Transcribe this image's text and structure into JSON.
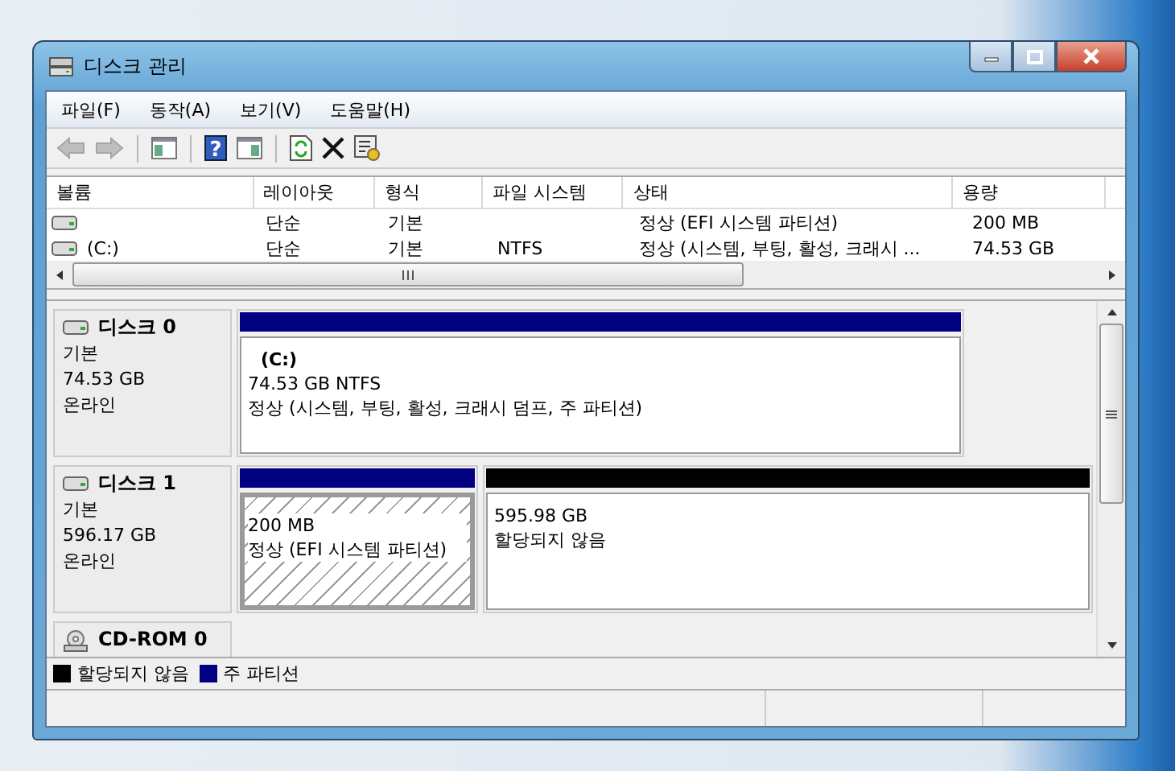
{
  "window": {
    "title": "디스크 관리"
  },
  "menu": [
    "파일(F)",
    "동작(A)",
    "보기(V)",
    "도움말(H)"
  ],
  "toolbar": [
    {
      "kind": "back",
      "disabled": true
    },
    {
      "kind": "forward",
      "disabled": true
    },
    {
      "kind": "sep"
    },
    {
      "kind": "panel-left",
      "disabled": false
    },
    {
      "kind": "sep"
    },
    {
      "kind": "help",
      "disabled": false,
      "glyph": "?"
    },
    {
      "kind": "panel-right",
      "disabled": false
    },
    {
      "kind": "sep"
    },
    {
      "kind": "refresh",
      "disabled": false
    },
    {
      "kind": "delete",
      "disabled": false
    },
    {
      "kind": "properties",
      "disabled": false
    }
  ],
  "volume_table": {
    "columns": [
      "볼륨",
      "레이아웃",
      "형식",
      "파일 시스템",
      "상태",
      "용량"
    ],
    "rows": [
      {
        "cells": [
          "",
          "단순",
          "기본",
          "",
          "정상 (EFI 시스템 파티션)",
          "200 MB"
        ]
      },
      {
        "cells": [
          "(C:)",
          "단순",
          "기본",
          "NTFS",
          "정상 (시스템, 부팅, 활성, 크래시 ...",
          "74.53 GB"
        ]
      }
    ]
  },
  "disks": [
    {
      "kind": "disk",
      "name": "디스크 0",
      "type": "기본",
      "size": "74.53 GB",
      "status": "온라인",
      "partitions": [
        {
          "kind": "primary",
          "selected": false,
          "label": "(C:)",
          "size": "74.53 GB NTFS",
          "status": "정상 (시스템, 부팅, 활성, 크래시 덤프, 주 파티션)"
        }
      ]
    },
    {
      "kind": "disk",
      "name": "디스크 1",
      "type": "기본",
      "size": "596.17 GB",
      "status": "온라인",
      "partitions": [
        {
          "kind": "primary",
          "selected": true,
          "size": "200 MB",
          "status": "정상 (EFI 시스템 파티션)"
        },
        {
          "kind": "unallocated",
          "selected": false,
          "size": "595.98 GB",
          "status": "할당되지 않음"
        }
      ]
    },
    {
      "kind": "cdrom",
      "name": "CD-ROM 0"
    }
  ],
  "legend": [
    {
      "label": "할당되지 않음",
      "color": "#000000"
    },
    {
      "label": "주 파티션",
      "color": "#000080"
    }
  ]
}
